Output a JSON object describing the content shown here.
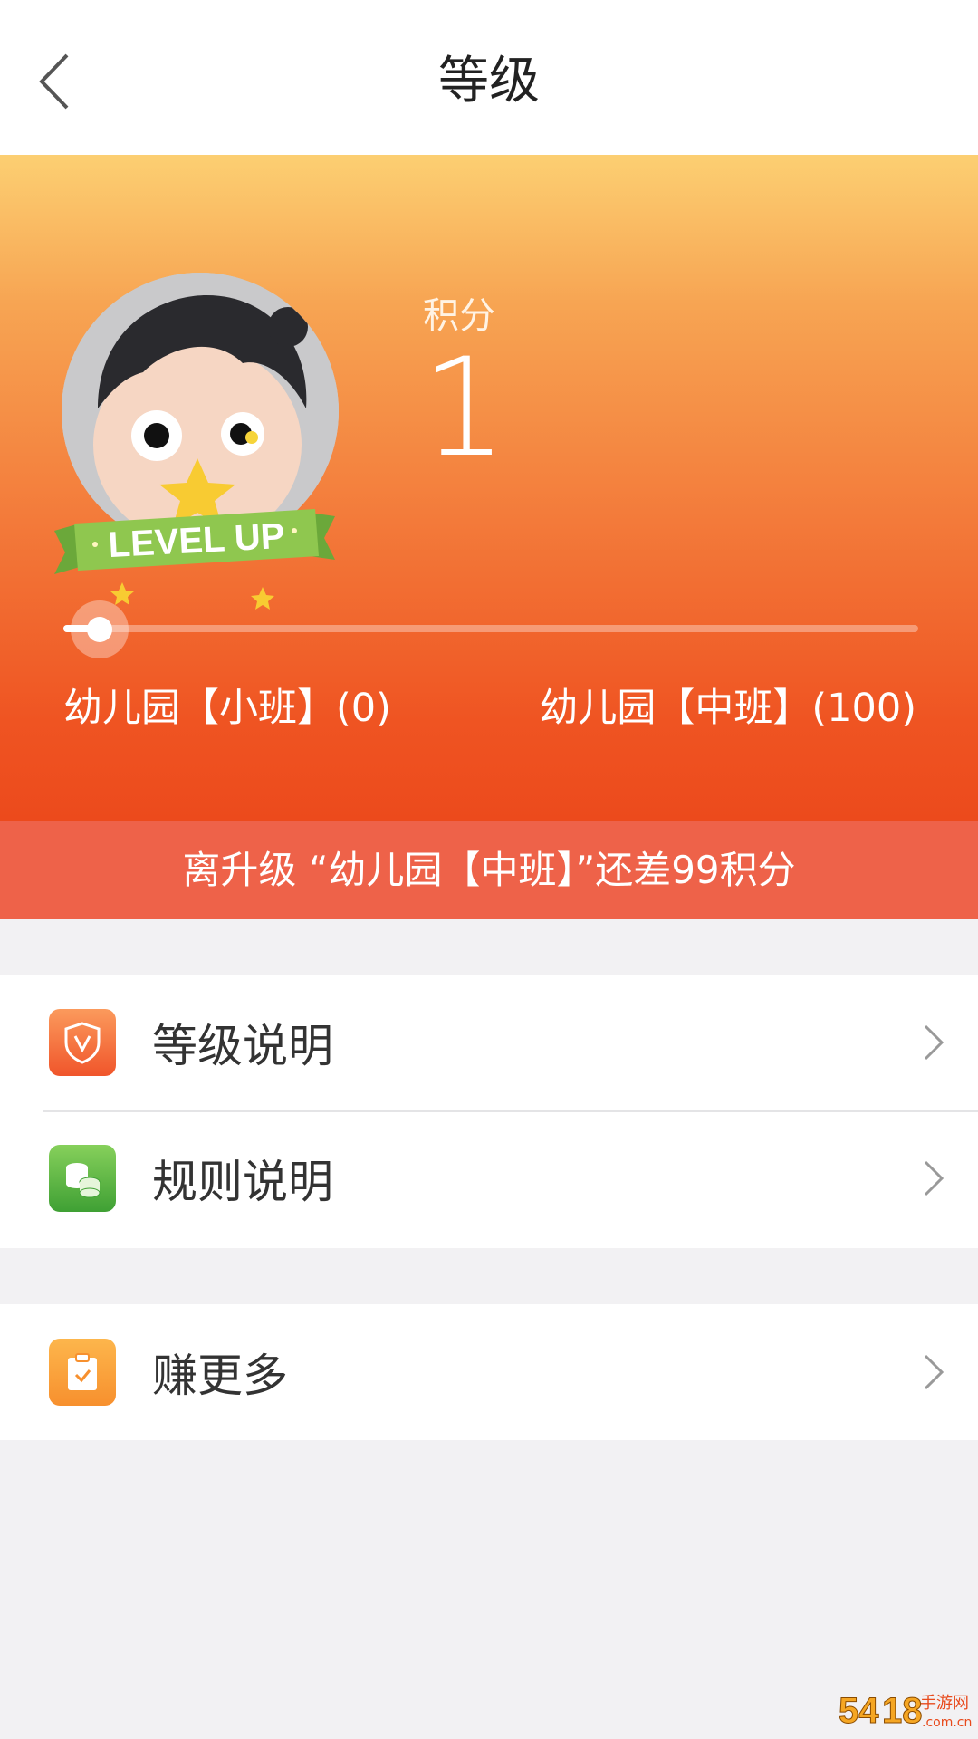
{
  "header": {
    "title": "等级",
    "back_icon": "chevron-left-icon"
  },
  "hero": {
    "badge_text": "LEVEL UP",
    "score_label": "积分",
    "score_value": "1",
    "progress_fraction": 0.01,
    "current_level": "幼儿园【小班】(0)",
    "next_level": "幼儿园【中班】(100)"
  },
  "upgrade_notice": "离升级 “幼儿园【中班】”还差99积分",
  "menu": {
    "group1": [
      {
        "label": "等级说明",
        "icon": "shield-v-icon"
      },
      {
        "label": "规则说明",
        "icon": "coins-icon"
      }
    ],
    "group2": [
      {
        "label": "赚更多",
        "icon": "clipboard-check-icon"
      }
    ]
  },
  "watermark": "5418手游网 .com.cn",
  "colors": {
    "hero_top": "#fccf72",
    "hero_bottom": "#ec4a1c",
    "banner": "#ee6249",
    "orange_icon": "#f0552b",
    "green_icon": "#3fa034",
    "yellow_icon": "#f7902e"
  }
}
